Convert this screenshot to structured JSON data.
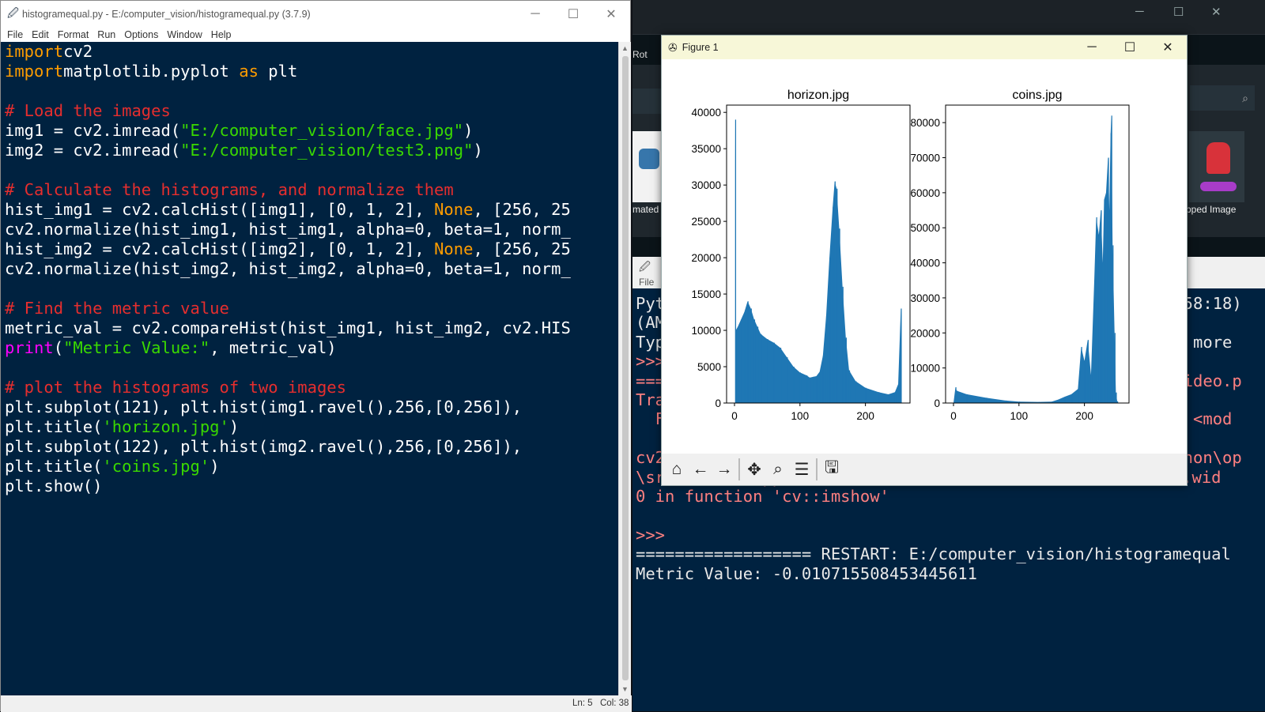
{
  "editor": {
    "title": "histogramequal.py - E:/computer_vision/histogramequal.py (3.7.9)",
    "menu": [
      "File",
      "Edit",
      "Format",
      "Run",
      "Options",
      "Window",
      "Help"
    ],
    "status": {
      "ln": "Ln: 5",
      "col": "Col: 38"
    },
    "lines": [
      [
        [
          "kw",
          "import"
        ],
        [
          "",
          "cv2"
        ]
      ],
      [
        [
          "kw",
          "import"
        ],
        [
          "",
          "matplotlib.pyplot "
        ],
        [
          "kw",
          "as"
        ],
        [
          "",
          " plt"
        ]
      ],
      [],
      [
        [
          "cm",
          "# Load the images"
        ]
      ],
      [
        [
          "",
          "img1 = cv2.imread("
        ],
        [
          "str",
          "\"E:/computer_vision/face.jpg\""
        ],
        [
          "",
          ")"
        ]
      ],
      [
        [
          "",
          "img2 = cv2.imread("
        ],
        [
          "str",
          "\"E:/computer_vision/test3.png\""
        ],
        [
          "",
          ")"
        ]
      ],
      [],
      [
        [
          "cm",
          "# Calculate the histograms, and normalize them"
        ]
      ],
      [
        [
          "",
          "hist_img1 = cv2.calcHist([img1], [0, 1, 2], "
        ],
        [
          "kw",
          "None"
        ],
        [
          "",
          ", [256, 25"
        ]
      ],
      [
        [
          "",
          "cv2.normalize(hist_img1, hist_img1, alpha=0, beta=1, norm_"
        ]
      ],
      [
        [
          "",
          "hist_img2 = cv2.calcHist([img2], [0, 1, 2], "
        ],
        [
          "kw",
          "None"
        ],
        [
          "",
          ", [256, 25"
        ]
      ],
      [
        [
          "",
          "cv2.normalize(hist_img2, hist_img2, alpha=0, beta=1, norm_"
        ]
      ],
      [],
      [
        [
          "cm",
          "# Find the metric value"
        ]
      ],
      [
        [
          "",
          "metric_val = cv2.compareHist(hist_img1, hist_img2, cv2.HIS"
        ]
      ],
      [
        [
          "bi",
          "print"
        ],
        [
          "",
          "("
        ],
        [
          "str",
          "\"Metric Value:\""
        ],
        [
          "",
          ", metric_val)"
        ]
      ],
      [],
      [
        [
          "cm",
          "# plot the histograms of two images"
        ]
      ],
      [
        [
          "",
          "plt.subplot(121), plt.hist(img1.ravel(),256,[0,256]),"
        ]
      ],
      [
        [
          "",
          "plt.title("
        ],
        [
          "str",
          "'horizon.jpg'"
        ],
        [
          "",
          ")"
        ]
      ],
      [
        [
          "",
          "plt.subplot(122), plt.hist(img2.ravel(),256,[0,256]),"
        ]
      ],
      [
        [
          "",
          "plt.title("
        ],
        [
          "str",
          "'coins.jpg'"
        ],
        [
          "",
          ")"
        ]
      ],
      [
        [
          "",
          "plt.show()"
        ]
      ]
    ]
  },
  "background": {
    "tab_label": "Rot",
    "thumb_left_label": "mated",
    "thumb_right_label": "pped Image"
  },
  "shell": {
    "menu_label": "File",
    "rows": [
      {
        "text": "Pyt",
        "cls": ""
      },
      {
        "text": "(AM",
        "cls": ""
      },
      {
        "text": "Typ",
        "cls": ""
      },
      {
        "text": ">>>",
        "cls": "err"
      },
      {
        "text": "===",
        "cls": "err"
      },
      {
        "text": "Tra",
        "cls": "err"
      },
      {
        "text": "  F",
        "cls": "err"
      },
      {
        "text": "",
        "cls": ""
      },
      {
        "text": "cv2",
        "cls": "err"
      },
      {
        "text": "\\src\\window.cpp:971: error: (-215:Assertion failed) size.wid",
        "cls": "err"
      },
      {
        "text": "0 in function 'cv::imshow'",
        "cls": "err"
      },
      {
        "text": "",
        "cls": ""
      },
      {
        "text": ">>>",
        "cls": "err"
      },
      {
        "text": "================== RESTART: E:/computer_vision/histogramequal",
        "cls": ""
      },
      {
        "text": "Metric Value: -0.010715508453445611",
        "cls": ""
      }
    ],
    "right_fragments": [
      "3:58:18)",
      "",
      "or more",
      "",
      "nvideo.p",
      "",
      "in <mod",
      "",
      "ython\\op"
    ]
  },
  "figure": {
    "title": "Figure 1",
    "bar_color": "#1f77b4"
  },
  "chart_data": [
    {
      "type": "bar",
      "title": "horizon.jpg",
      "xlim": [
        0,
        256
      ],
      "ylim": [
        0,
        41000
      ],
      "yticks": [
        0,
        5000,
        10000,
        15000,
        20000,
        25000,
        30000,
        35000,
        40000
      ],
      "xticks": [
        0,
        100,
        200
      ],
      "bins": [
        [
          1,
          39000
        ],
        [
          2,
          10000
        ],
        [
          5,
          10500
        ],
        [
          10,
          11500
        ],
        [
          15,
          12500
        ],
        [
          20,
          14000
        ],
        [
          25,
          13000
        ],
        [
          30,
          11500
        ],
        [
          35,
          10500
        ],
        [
          40,
          9500
        ],
        [
          50,
          8800
        ],
        [
          60,
          8300
        ],
        [
          70,
          7600
        ],
        [
          80,
          6300
        ],
        [
          90,
          5000
        ],
        [
          100,
          4200
        ],
        [
          110,
          3800
        ],
        [
          115,
          3500
        ],
        [
          120,
          3600
        ],
        [
          125,
          3700
        ],
        [
          130,
          4300
        ],
        [
          135,
          6500
        ],
        [
          140,
          12000
        ],
        [
          145,
          20000
        ],
        [
          150,
          27000
        ],
        [
          153,
          30500
        ],
        [
          156,
          29500
        ],
        [
          160,
          24000
        ],
        [
          165,
          16000
        ],
        [
          170,
          9000
        ],
        [
          175,
          4500
        ],
        [
          185,
          3000
        ],
        [
          200,
          2100
        ],
        [
          220,
          1500
        ],
        [
          235,
          1200
        ],
        [
          245,
          1500
        ],
        [
          250,
          2600
        ],
        [
          254,
          13000
        ]
      ]
    },
    {
      "type": "bar",
      "title": "coins.jpg",
      "xlim": [
        0,
        256
      ],
      "ylim": [
        0,
        85000
      ],
      "yticks": [
        0,
        10000,
        20000,
        30000,
        40000,
        50000,
        60000,
        70000,
        80000
      ],
      "xticks": [
        0,
        100,
        200
      ],
      "bins": [
        [
          0,
          0
        ],
        [
          3,
          4500
        ],
        [
          5,
          3500
        ],
        [
          20,
          2500
        ],
        [
          50,
          1500
        ],
        [
          80,
          700
        ],
        [
          100,
          400
        ],
        [
          130,
          300
        ],
        [
          150,
          400
        ],
        [
          160,
          1000
        ],
        [
          170,
          1800
        ],
        [
          180,
          2500
        ],
        [
          190,
          4000
        ],
        [
          195,
          16000
        ],
        [
          200,
          12000
        ],
        [
          205,
          18000
        ],
        [
          210,
          8000
        ],
        [
          215,
          35000
        ],
        [
          218,
          53000
        ],
        [
          222,
          48000
        ],
        [
          225,
          55000
        ],
        [
          228,
          40000
        ],
        [
          230,
          58000
        ],
        [
          233,
          60000
        ],
        [
          236,
          70000
        ],
        [
          238,
          55000
        ],
        [
          240,
          77000
        ],
        [
          241,
          82000
        ],
        [
          243,
          45000
        ],
        [
          246,
          20000
        ],
        [
          248,
          3000
        ],
        [
          250,
          500
        ]
      ]
    }
  ]
}
